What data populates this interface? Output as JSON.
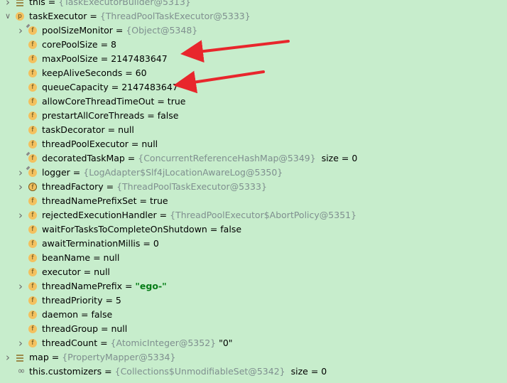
{
  "rows": [
    {
      "indent": 0,
      "arrow": "expand",
      "icon": "lines",
      "name": "this",
      "sep": " = ",
      "ref": "{TaskExecutorBuilder@5313}",
      "value": "",
      "size": ""
    },
    {
      "indent": 0,
      "arrow": "collapse",
      "icon": "p",
      "name": "taskExecutor",
      "sep": " = ",
      "ref": "{ThreadPoolTaskExecutor@5333}",
      "value": "",
      "size": ""
    },
    {
      "indent": 1,
      "arrow": "expand",
      "icon": "f-pin",
      "name": "poolSizeMonitor",
      "sep": " = ",
      "ref": "{Object@5348}",
      "value": "",
      "size": ""
    },
    {
      "indent": 1,
      "arrow": "",
      "icon": "f",
      "name": "corePoolSize",
      "sep": " = ",
      "ref": "",
      "value": "8",
      "size": ""
    },
    {
      "indent": 1,
      "arrow": "",
      "icon": "f",
      "name": "maxPoolSize",
      "sep": " = ",
      "ref": "",
      "value": "2147483647",
      "size": ""
    },
    {
      "indent": 1,
      "arrow": "",
      "icon": "f",
      "name": "keepAliveSeconds",
      "sep": " = ",
      "ref": "",
      "value": "60",
      "size": ""
    },
    {
      "indent": 1,
      "arrow": "",
      "icon": "f",
      "name": "queueCapacity",
      "sep": " = ",
      "ref": "",
      "value": "2147483647",
      "size": ""
    },
    {
      "indent": 1,
      "arrow": "",
      "icon": "f",
      "name": "allowCoreThreadTimeOut",
      "sep": " = ",
      "ref": "",
      "value": "true",
      "size": ""
    },
    {
      "indent": 1,
      "arrow": "",
      "icon": "f",
      "name": "prestartAllCoreThreads",
      "sep": " = ",
      "ref": "",
      "value": "false",
      "size": ""
    },
    {
      "indent": 1,
      "arrow": "",
      "icon": "f",
      "name": "taskDecorator",
      "sep": " = ",
      "ref": "",
      "value": "null",
      "size": ""
    },
    {
      "indent": 1,
      "arrow": "",
      "icon": "f",
      "name": "threadPoolExecutor",
      "sep": " = ",
      "ref": "",
      "value": "null",
      "size": ""
    },
    {
      "indent": 1,
      "arrow": "",
      "icon": "f-pin",
      "name": "decoratedTaskMap",
      "sep": " = ",
      "ref": "{ConcurrentReferenceHashMap@5349}",
      "value": "",
      "size": "size = 0"
    },
    {
      "indent": 1,
      "arrow": "expand",
      "icon": "f-pin",
      "name": "logger",
      "sep": " = ",
      "ref": "{LogAdapter$Slf4jLocationAwareLog@5350}",
      "value": "",
      "size": ""
    },
    {
      "indent": 1,
      "arrow": "expand",
      "icon": "f-outline",
      "name": "threadFactory",
      "sep": " = ",
      "ref": "{ThreadPoolTaskExecutor@5333}",
      "value": "",
      "size": ""
    },
    {
      "indent": 1,
      "arrow": "",
      "icon": "f",
      "name": "threadNamePrefixSet",
      "sep": " = ",
      "ref": "",
      "value": "true",
      "size": ""
    },
    {
      "indent": 1,
      "arrow": "expand",
      "icon": "f",
      "name": "rejectedExecutionHandler",
      "sep": " = ",
      "ref": "{ThreadPoolExecutor$AbortPolicy@5351}",
      "value": "",
      "size": ""
    },
    {
      "indent": 1,
      "arrow": "",
      "icon": "f",
      "name": "waitForTasksToCompleteOnShutdown",
      "sep": " = ",
      "ref": "",
      "value": "false",
      "size": ""
    },
    {
      "indent": 1,
      "arrow": "",
      "icon": "f",
      "name": "awaitTerminationMillis",
      "sep": " = ",
      "ref": "",
      "value": "0",
      "size": ""
    },
    {
      "indent": 1,
      "arrow": "",
      "icon": "f",
      "name": "beanName",
      "sep": " = ",
      "ref": "",
      "value": "null",
      "size": ""
    },
    {
      "indent": 1,
      "arrow": "",
      "icon": "f",
      "name": "executor",
      "sep": " = ",
      "ref": "",
      "value": "null",
      "size": ""
    },
    {
      "indent": 1,
      "arrow": "expand",
      "icon": "f",
      "name": "threadNamePrefix",
      "sep": " = ",
      "ref": "",
      "value": "",
      "str": "\"ego-\"",
      "size": ""
    },
    {
      "indent": 1,
      "arrow": "",
      "icon": "f",
      "name": "threadPriority",
      "sep": " = ",
      "ref": "",
      "value": "5",
      "size": ""
    },
    {
      "indent": 1,
      "arrow": "",
      "icon": "f",
      "name": "daemon",
      "sep": " = ",
      "ref": "",
      "value": "false",
      "size": ""
    },
    {
      "indent": 1,
      "arrow": "",
      "icon": "f",
      "name": "threadGroup",
      "sep": " = ",
      "ref": "",
      "value": "null",
      "size": ""
    },
    {
      "indent": 1,
      "arrow": "expand",
      "icon": "f",
      "name": "threadCount",
      "sep": " = ",
      "ref": "{AtomicInteger@5352}",
      "value": "\"0\"",
      "size": ""
    },
    {
      "indent": 0,
      "arrow": "expand",
      "icon": "lines",
      "name": "map",
      "sep": " = ",
      "ref": "{PropertyMapper@5334}",
      "value": "",
      "size": ""
    },
    {
      "indent": 0,
      "arrow": "",
      "icon": "infinity",
      "name": "this.customizers",
      "sep": " = ",
      "ref": "{Collections$UnmodifiableSet@5342}",
      "value": "",
      "size": "size = 0"
    }
  ],
  "colors": {
    "background": "#c7edcc",
    "annotation_arrow": "#e8262c",
    "reference_text": "#7f8f8f",
    "string_value": "#067d17"
  }
}
